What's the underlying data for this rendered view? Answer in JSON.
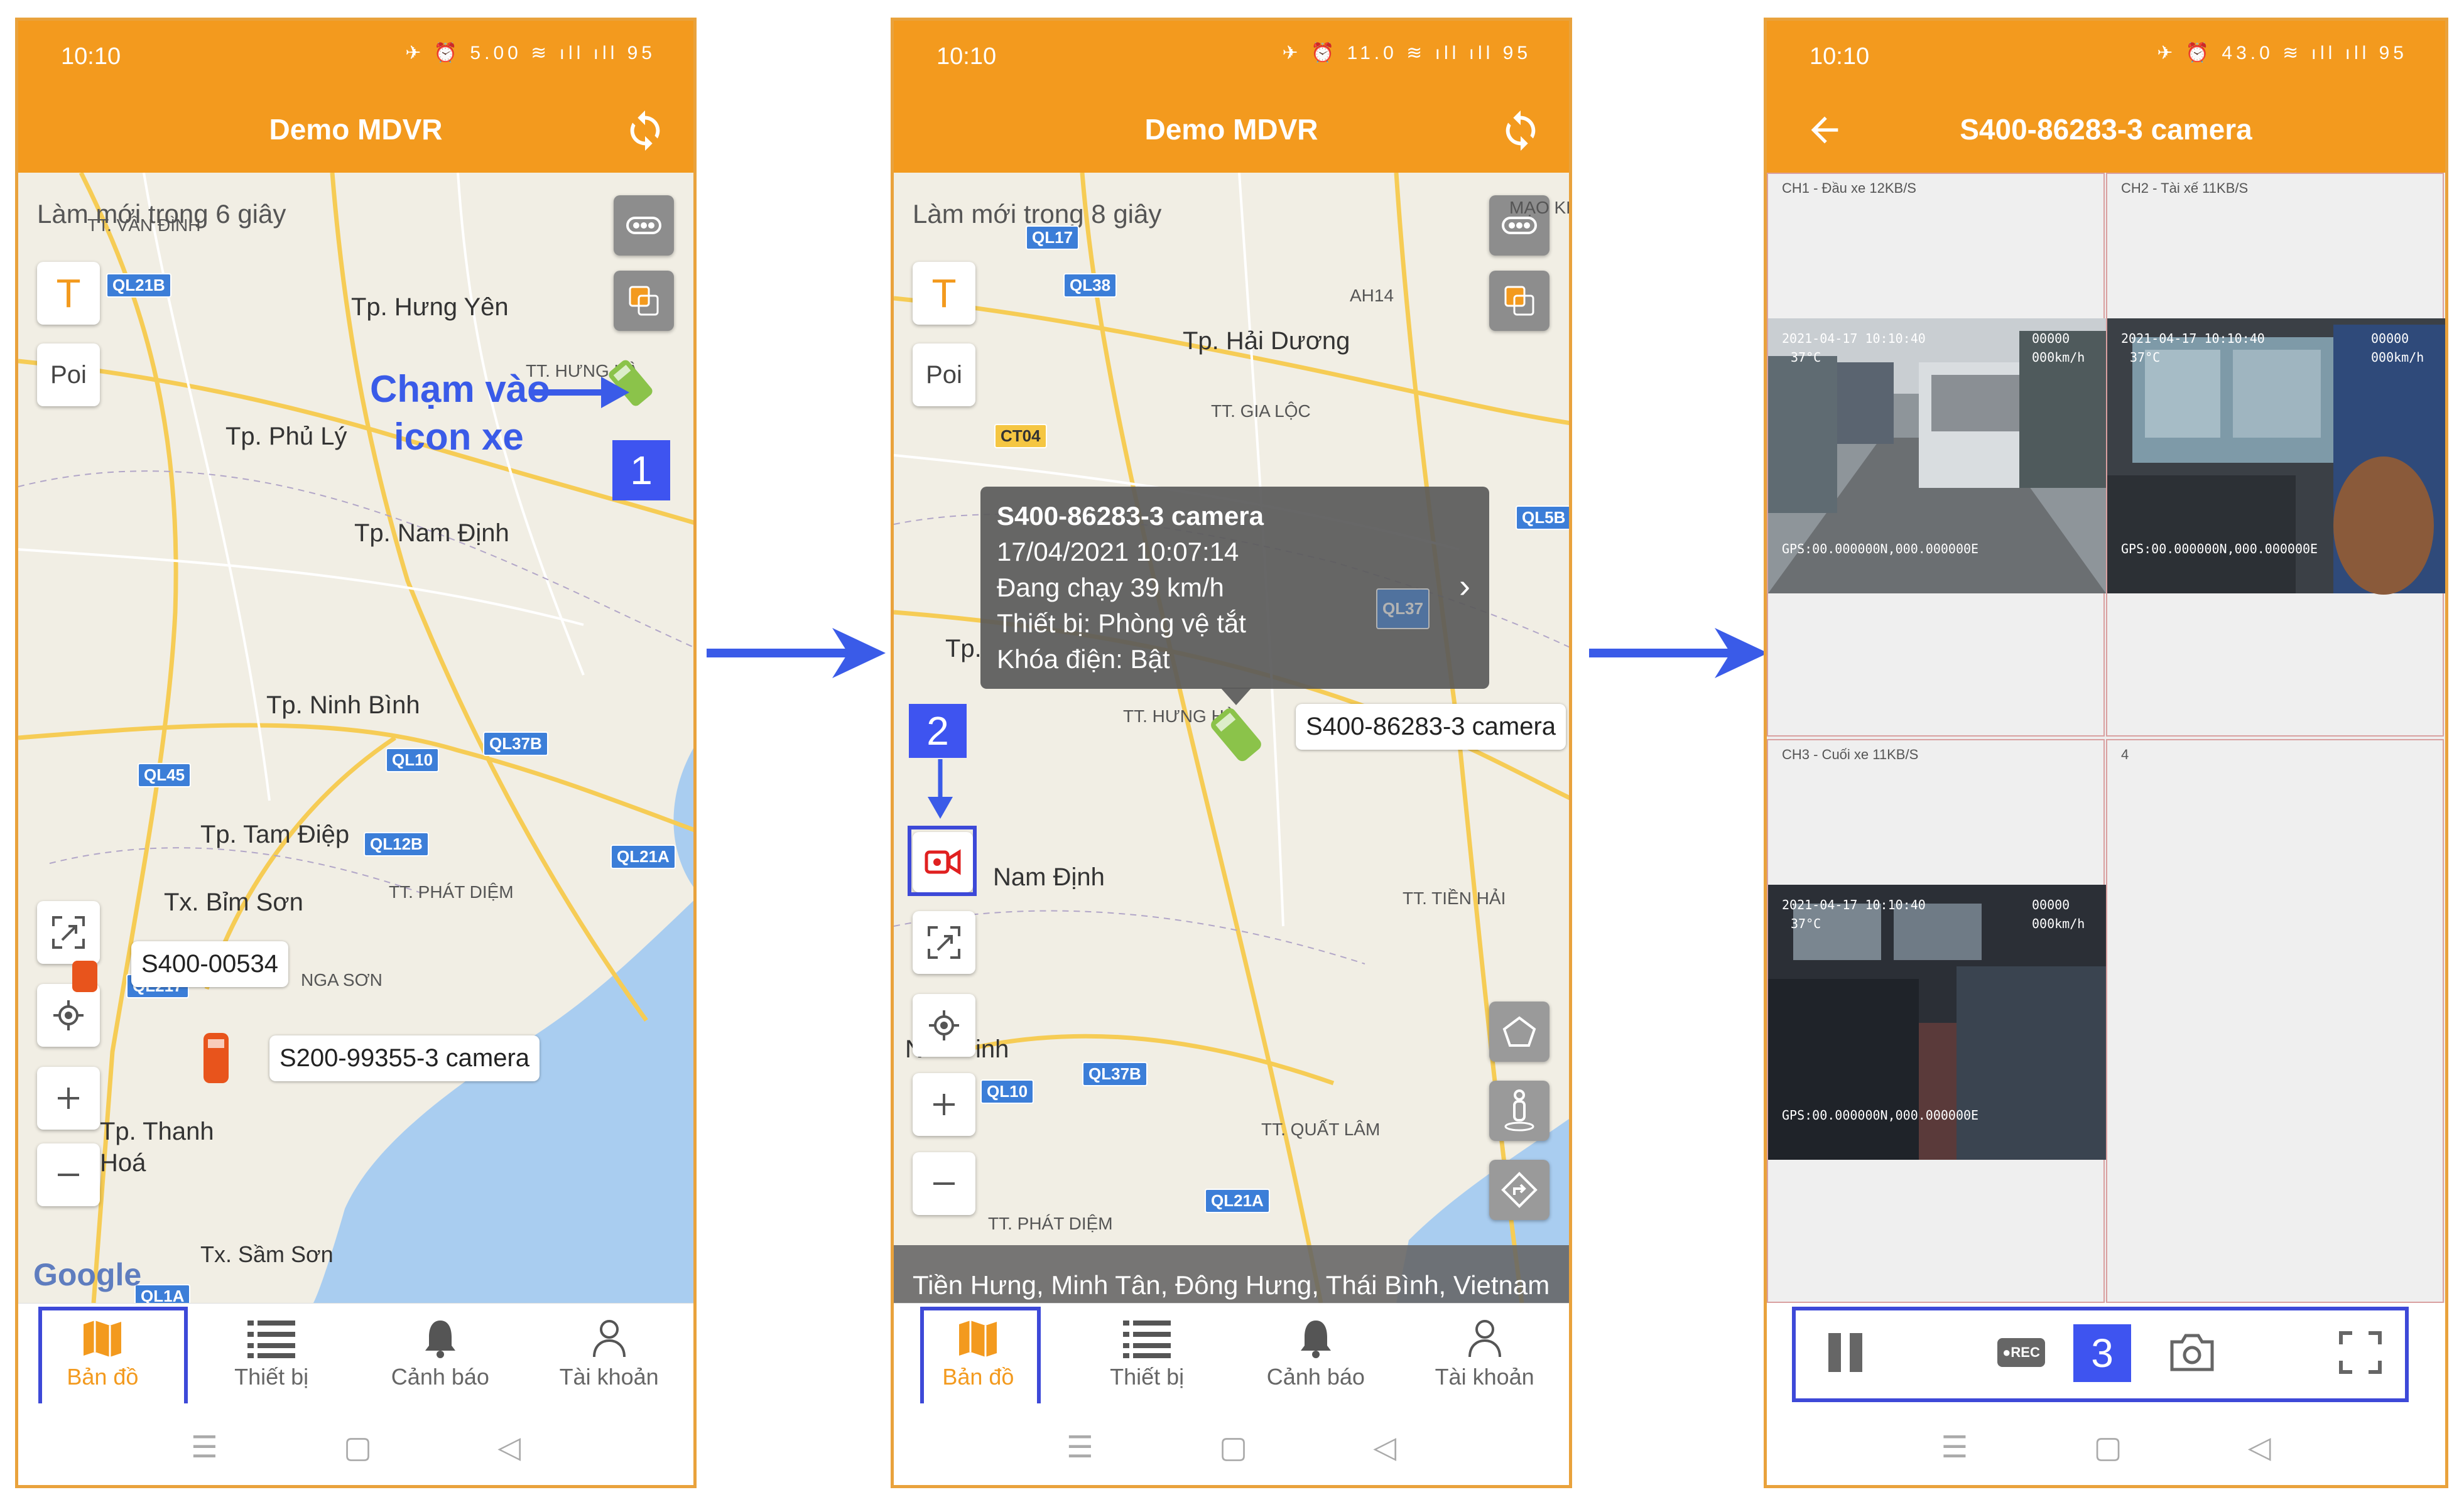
{
  "screens": [
    {
      "status_time": "10:10",
      "status_icons": "✈ ⏰ 5.00 ≋ ıll ıll 95",
      "title": "Demo MDVR",
      "refresh_note": "Làm mới trong 6 giây",
      "btn_text": "T",
      "btn_poi": "Poi",
      "places": {
        "van_dinh": "TT. VÂN ĐÌNH",
        "hung_yen": "Tp. Hưng Yên",
        "phu_ly": "Tp. Phủ Lý",
        "nam_dinh": "Tp. Nam Định",
        "ninh_binh": "Tp. Ninh Bình",
        "tam_diep": "Tp. Tam Điệp",
        "bim_son": "Tx. Bỉm Sơn",
        "phat_diem": "TT. PHÁT DIỆM",
        "nga_son": "NGA SƠN",
        "thanh_hoa": "Tp. Thanh Hoá",
        "sam_son": "Tx. Sầm Sơn",
        "hung_ha": "TT. HƯNG HÀ"
      },
      "roads": [
        "QL21B",
        "QL45",
        "QL10",
        "QL37B",
        "QL12B",
        "QL21A",
        "QL217",
        "QL1A"
      ],
      "vehicle_labels": [
        "S400-00534",
        "S200-99355-3 camera"
      ],
      "annotation_text_1": "Chạm vào",
      "annotation_text_2": "icon xe",
      "step": "1",
      "google": "Google"
    },
    {
      "status_time": "10:10",
      "status_icons": "✈ ⏰ 11.0 ≋ ıll ıll 95",
      "title": "Demo MDVR",
      "refresh_note": "Làm mới trong 8 giây",
      "btn_text": "T",
      "btn_poi": "Poi",
      "places": {
        "hai_duong": "Tp. Hải Dương",
        "gia_loc": "TT. GIA LỘC",
        "ah14": "AH14",
        "nam_dinh": "Nam Định",
        "tien_hai": "TT. TIỀN HẢI",
        "quat_lam": "TT. QUẤT LÂM",
        "phat_diem": "TT. PHÁT DIỆM",
        "hung_ha": "TT. HƯNG HÀ",
        "mao_khe": "MẠO KH",
        "tp": "Tp.",
        "nh": "N",
        "inh": "inh"
      },
      "roads": [
        "QL17",
        "QL38",
        "CT04",
        "QL5B",
        "QL37",
        "QL10",
        "QL37B",
        "QL21A"
      ],
      "popup": {
        "title": "S400-86283-3 camera",
        "datetime": "17/04/2021 10:07:14",
        "status": "Đang chạy   39 km/h",
        "device": "Thiết bị:   Phòng vệ tắt",
        "ignition": "Khóa điện:  Bật"
      },
      "vehicle_label": "S400-86283-3 camera",
      "address": "Tiền Hưng, Minh Tân, Đông Hưng, Thái Bình, Vietnam",
      "step": "2"
    },
    {
      "status_time": "10:10",
      "status_icons": "✈ ⏰ 43.0 ≋ ıll ıll 95",
      "title": "S400-86283-3 camera",
      "channels": [
        {
          "label": "CH1 - Đầu xe  12KB/S",
          "osd_time": "2021-04-17 10:10:40",
          "osd_temp": "37°C",
          "osd_speed": "000km/h",
          "osd_id": "00000",
          "osd_gps": "GPS:00.000000N,000.000000E"
        },
        {
          "label": "CH2 - Tài xế  11KB/S",
          "osd_time": "2021-04-17 10:10:40",
          "osd_temp": "37°C",
          "osd_speed": "000km/h",
          "osd_id": "00000",
          "osd_gps": "GPS:00.000000N,000.000000E"
        },
        {
          "label": "CH3 - Cuối xe  11KB/S",
          "osd_time": "2021-04-17 10:10:40",
          "osd_temp": "37°C",
          "osd_speed": "000km/h",
          "osd_id": "00000",
          "osd_gps": "GPS:00.000000N,000.000000E"
        },
        {
          "label": "4"
        }
      ],
      "rec_label": "●REC",
      "step": "3"
    }
  ],
  "nav": {
    "map": "Bản đồ",
    "devices": "Thiết bị",
    "alerts": "Cảnh báo",
    "account": "Tài khoản"
  },
  "colors": {
    "brand": "#f39a1e",
    "annotation": "#3d49d8",
    "road_badge": "#3c7ed8",
    "vehicle_green": "#8bc34a",
    "vehicle_orange": "#e8541c",
    "record": "#e02020"
  }
}
